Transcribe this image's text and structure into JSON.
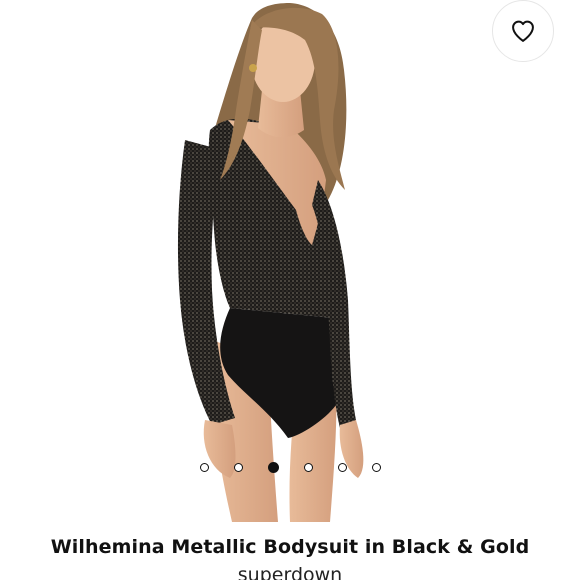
{
  "product": {
    "title": "Wilhemina Metallic Bodysuit in Black & Gold",
    "brand": "superdown"
  },
  "wishlist": {
    "icon": "heart-outline-icon"
  },
  "gallery": {
    "total_images": 6,
    "active_index": 3
  },
  "colors": {
    "text": "#111111",
    "background": "#ffffff",
    "border": "#e6e6e6"
  }
}
